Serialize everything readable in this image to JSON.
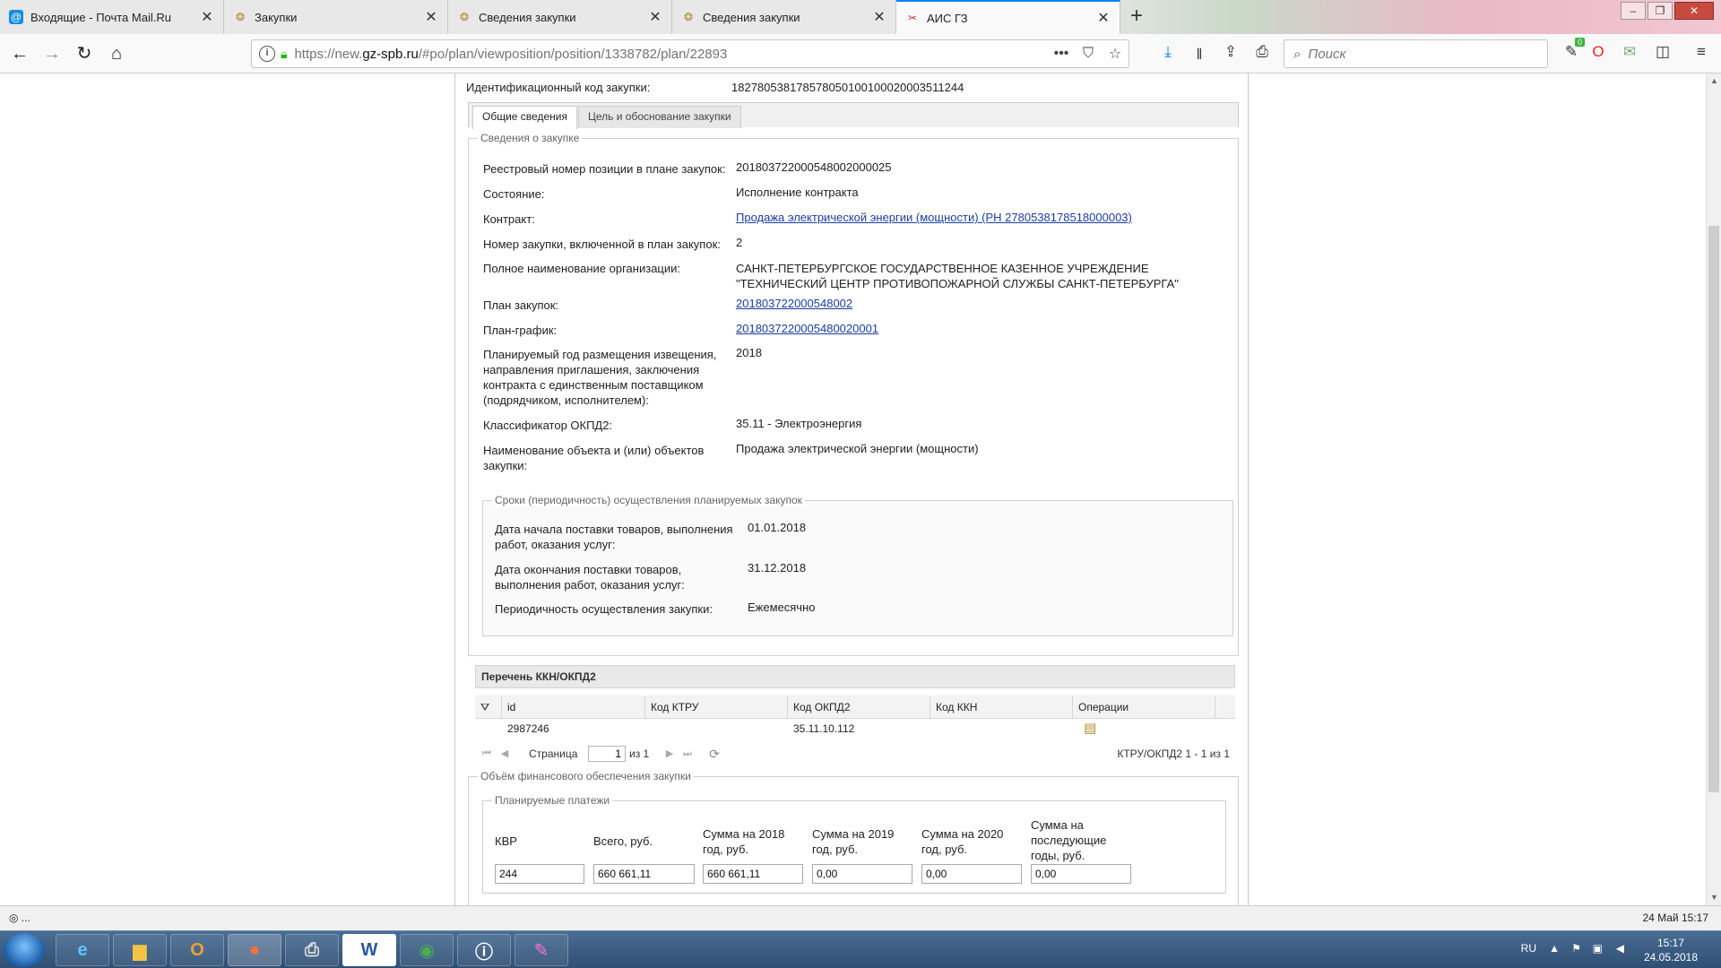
{
  "browser": {
    "tabs": [
      {
        "title": "Входящие - Почта Mail.Ru",
        "icon": "mail-icon"
      },
      {
        "title": "Закупки",
        "icon": "emblem-icon"
      },
      {
        "title": "Сведения закупки",
        "icon": "emblem-icon"
      },
      {
        "title": "Сведения закупки",
        "icon": "emblem-icon"
      },
      {
        "title": "АИС ГЗ",
        "icon": "tools-icon"
      }
    ],
    "active_tab": 4,
    "url_prefix": "https://new.",
    "url_domain": "gz-spb.ru",
    "url_suffix": "/#po/plan/viewposition/position/1338782/plan/22893",
    "search_placeholder": "Поиск",
    "addon_badge": "0",
    "accent": "#0a84ff"
  },
  "page": {
    "id_code_label": "Идентификационный код закупки:",
    "id_code_value": "182780538178578050100100020003511244",
    "tabs": [
      "Общие сведения",
      "Цель и обоснование закупки"
    ],
    "section_title": "Сведения о закупке",
    "fields": [
      {
        "label": "Реестровый номер позиции в плане закупок:",
        "value": "20180372200054800200002​5"
      },
      {
        "label": "Состояние:",
        "value": "Исполнение контракта"
      },
      {
        "label": "Контракт:",
        "value": "Продажа электрической энергии (мощности) (РН 2780538178518000003)"
      },
      {
        "label": "Номер закупки, включенной в план закупок:",
        "value": "2"
      },
      {
        "label": "Полное наименование организации:",
        "value": "САНКТ-ПЕТЕРБУРГСКОЕ ГОСУДАРСТВЕННОЕ КАЗЕННОЕ УЧРЕЖДЕНИЕ \"ТЕХНИЧЕСКИЙ ЦЕНТР ПРОТИВОПОЖАРНОЙ СЛУЖБЫ САНКТ-ПЕТЕРБУРГА\""
      },
      {
        "label": "План закупок:",
        "value": "201803722000548002"
      },
      {
        "label": "План-график:",
        "value": "201803722000548002000​1"
      },
      {
        "label": "Планируемый год размещения извещения, направления приглашения, заключения контракта с единственным поставщиком (подрядчиком, исполнителем):",
        "value": "2018"
      },
      {
        "label": "Классификатор ОКПД2:",
        "value": "35.11 - Электроэнергия"
      },
      {
        "label": "Наименование объекта и (или) объектов закупки:",
        "value": "Продажа электрической энергии (мощности)"
      }
    ],
    "terms_title": "Сроки (периодичность) осуществления планируемых закупок",
    "terms": [
      {
        "label": "Дата начала поставки товаров, выполнения работ, оказания услуг:",
        "value": "01.01.2018"
      },
      {
        "label": "Дата окончания поставки товаров, выполнения работ, оказания услуг:",
        "value": "31.12.2018"
      },
      {
        "label": "Периодичность осуществления закупки:",
        "value": "Ежемесячно"
      }
    ],
    "grid": {
      "title": "Перечень ККН/ОКПД2",
      "columns": [
        "id",
        "Код КТРУ",
        "Код ОКПД2",
        "Код ККН",
        "Операции"
      ],
      "rows": [
        [
          "2987246",
          "",
          "35.11.10.112",
          "",
          ""
        ]
      ],
      "page_label": "Страница",
      "page_value": "1",
      "of_label": "из 1",
      "summary": "КТРУ/ОКПД2 1 - 1 из 1"
    },
    "finance_title": "Объём финансового обеспечения закупки",
    "payments_title": "Планируемые платежи",
    "payments": {
      "headers": [
        "КВР",
        "Всего, руб.",
        "Сумма на 2018 год, руб.",
        "Сумма на 2019 год, руб.",
        "Сумма на 2020 год, руб.",
        "Сумма на последующие годы, руб."
      ],
      "values": [
        "244",
        "660 661,11",
        "660 661,11",
        "0,00",
        "0,00",
        "0,00"
      ]
    }
  },
  "statusbar": {
    "left": "◎ ...",
    "right": "24 Май 15:17"
  },
  "taskbar": {
    "lang": "RU",
    "time": "15:17",
    "date": "24.05.2018"
  }
}
